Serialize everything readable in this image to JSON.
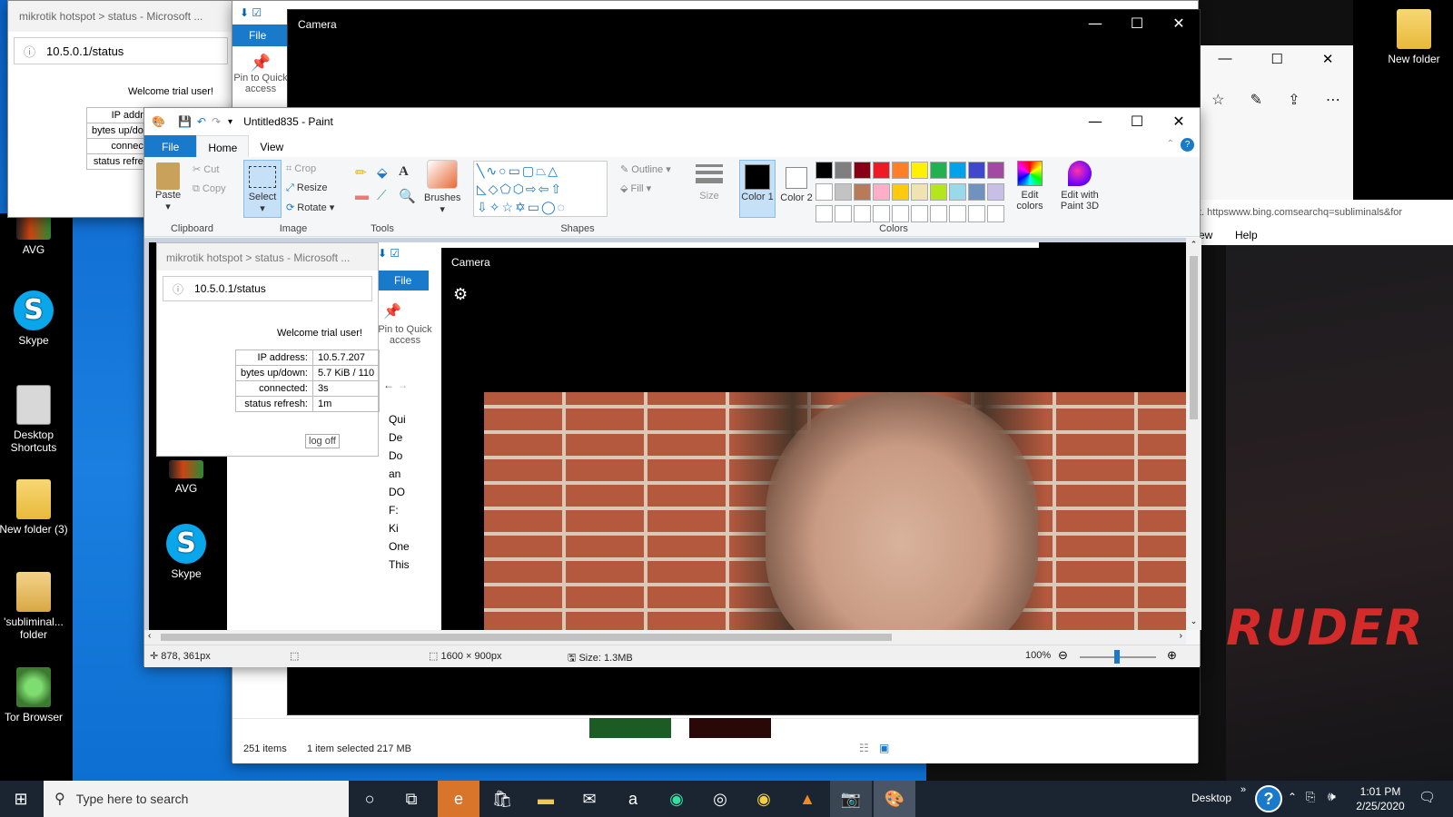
{
  "colors": {
    "accent": "#0063b1",
    "paint_tab": "#1979ca",
    "camera_bg": "#000000",
    "taskbar": "#1b2532"
  },
  "desktop": {
    "left_icons": [
      {
        "label": "AVG",
        "icon": "avg-icon"
      },
      {
        "label": "Skype",
        "icon": "skype-icon"
      },
      {
        "label": "Desktop Shortcuts",
        "icon": "shortcut-icon"
      },
      {
        "label": "New folder (3)",
        "icon": "folder-icon"
      },
      {
        "label": "'subliminal... folder",
        "icon": "folder-icon"
      },
      {
        "label": "Tor Browser",
        "icon": "tor-icon"
      }
    ],
    "right_icon": {
      "label": "New folder",
      "icon": "folder-icon"
    },
    "wallpaper_text": "RUDER"
  },
  "edge_bg": {
    "title": "mikrotik hotspot > status - Microsoft ...",
    "address": "10.5.0.1/status",
    "welcome": "Welcome trial user!",
    "rows": [
      "IP addr",
      "bytes up/do",
      "connec",
      "status refre"
    ]
  },
  "explorer_bg": {
    "file_tab": "File",
    "pin_label": "Pin to Quick access",
    "help_label": "Help",
    "address_fragment": "t. httpswww.bing.comsearchq=subliminals&for",
    "view_fragment": "ew",
    "status_items": "251 items",
    "status_selected": "1 item selected  217 MB"
  },
  "camera_bg": {
    "title": "Camera"
  },
  "paint": {
    "title": "Untitled835 - Paint",
    "tabs": [
      "File",
      "Home",
      "View"
    ],
    "clipboard": {
      "paste": "Paste",
      "cut": "Cut",
      "copy": "Copy",
      "label": "Clipboard"
    },
    "image": {
      "select": "Select",
      "crop": "Crop",
      "resize": "Resize",
      "rotate": "Rotate",
      "label": "Image"
    },
    "tools": {
      "label": "Tools"
    },
    "brushes": "Brushes",
    "shapes": {
      "label": "Shapes",
      "outline": "Outline",
      "fill": "Fill"
    },
    "size": "Size",
    "color1": "Color 1",
    "color2": "Color 2",
    "colors_label": "Colors",
    "edit_colors": "Edit colors",
    "edit_3d": "Edit with Paint 3D",
    "palette_row1": [
      "#000000",
      "#7f7f7f",
      "#880015",
      "#ed1c24",
      "#ff7f27",
      "#fff200",
      "#22b14c",
      "#00a2e8",
      "#3f48cc",
      "#a349a4"
    ],
    "palette_row2": [
      "#ffffff",
      "#c3c3c3",
      "#b97a57",
      "#ffaec9",
      "#ffc90e",
      "#efe4b0",
      "#b5e61d",
      "#99d9ea",
      "#7092be",
      "#c8bfe7"
    ],
    "status": {
      "position": "878, 361px",
      "dimensions": "1600 × 900px",
      "size": "Size: 1.3MB",
      "zoom": "100%"
    }
  },
  "canvas": {
    "edge_title": "mikrotik hotspot > status - Microsoft ...",
    "edge_address": "10.5.0.1/status",
    "welcome": "Welcome trial user!",
    "table": [
      {
        "k": "IP address:",
        "v": "10.5.7.207"
      },
      {
        "k": "bytes up/down:",
        "v": "5.7 KiB / 110"
      },
      {
        "k": "connected:",
        "v": "3s"
      },
      {
        "k": "status refresh:",
        "v": "1m"
      }
    ],
    "logoff": "log off",
    "explorer_file": "File",
    "explorer_pin": "Pin to Quick access",
    "explorer_nav": [
      "Qui",
      "De",
      "Do",
      "an",
      "DO",
      "F:",
      "Ki",
      "One",
      "This"
    ],
    "avg_label": "AVG",
    "skype_label": "Skype",
    "camera_title": "Camera"
  },
  "taskbar": {
    "search_placeholder": "Type here to search",
    "desktop_label": "Desktop",
    "time": "1:01 PM",
    "date": "2/25/2020"
  }
}
